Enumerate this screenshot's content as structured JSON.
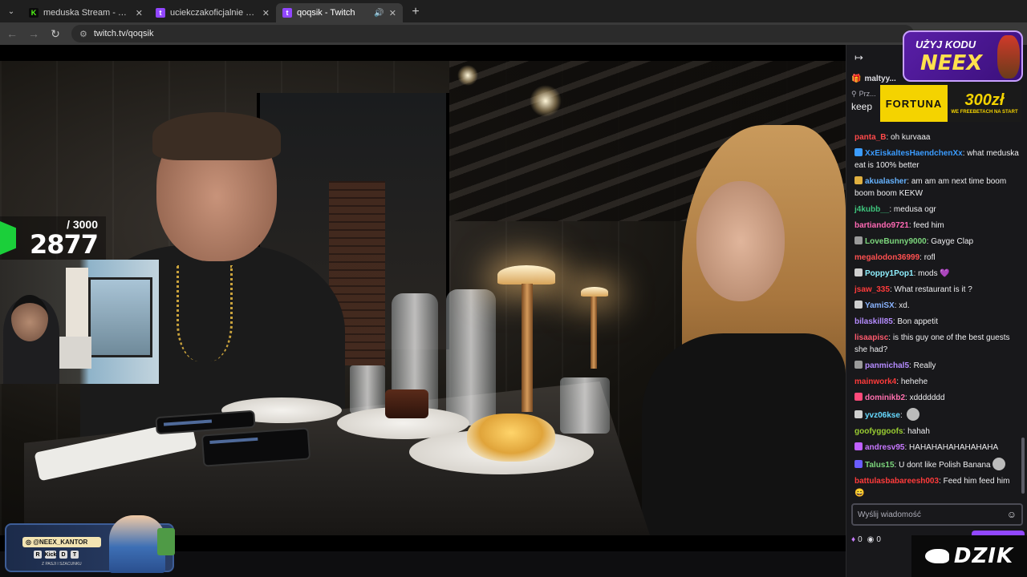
{
  "browser": {
    "tabs": [
      {
        "title": "meduska Stream - Watch Live o",
        "favicon": "kick-k-icon",
        "favicon_color": "#53fc18",
        "active": false
      },
      {
        "title": "uciekczakoficjalnie XD - Twitch",
        "favicon": "twitch-icon",
        "favicon_color": "#9146ff",
        "active": false
      },
      {
        "title": "qoqsik - Twitch",
        "favicon": "twitch-icon",
        "favicon_color": "#9146ff",
        "active": true
      }
    ],
    "url": "twitch.tv/qoqsik"
  },
  "stream": {
    "counter_goal": "/ 3000",
    "counter_value": "2877",
    "counter_color": "#1bcf3a",
    "promo_handle": "@NEEX_KANTOR",
    "promo_icons": [
      "R",
      "Kick",
      "D",
      "T"
    ],
    "promo_sub": "Z PASJI I SZACUNKU"
  },
  "chat": {
    "pinned_user": "maltyy...",
    "pinned_label": "Prz...",
    "pinned_text": "keep",
    "ad_neex": {
      "line1": "UŻYJ KODU",
      "line2": "NEEX"
    },
    "ad_fortuna": {
      "brand": "FORTUNA",
      "amount": "300zł",
      "tag": "WE FREEBETACH NA START"
    },
    "messages": [
      {
        "user": "panta_B",
        "color": "#ff4a4a",
        "text": "oh kurvaaa",
        "badge": ""
      },
      {
        "user": "XxEiskaltesHaendchenXx",
        "color": "#3b9cff",
        "text": "what meduska eat is 100% better",
        "badge": "#3b9cff"
      },
      {
        "user": "akualasher",
        "color": "#66b3ff",
        "text": "am am am next time boom boom boom KEKW",
        "badge": "#e0b040"
      },
      {
        "user": "j4kubb__",
        "color": "#3ec47c",
        "text": "medusa ogr",
        "badge": ""
      },
      {
        "user": "bartiando9721",
        "color": "#ff69b4",
        "text": "feed him",
        "badge": ""
      },
      {
        "user": "LoveBunny9000",
        "color": "#7cd67c",
        "text": "Gayge Clap",
        "badge": "#9a9a9a"
      },
      {
        "user": "megalodon36999",
        "color": "#ff5050",
        "text": "rofl",
        "badge": ""
      },
      {
        "user": "Poppy1Pop1",
        "color": "#8ff0ff",
        "text": "mods 💜",
        "badge": "#cfcfcf"
      },
      {
        "user": "jsaw_335",
        "color": "#ff3b3b",
        "text": "What restaurant is it ?",
        "badge": ""
      },
      {
        "user": "YamiSX",
        "color": "#8ab4ff",
        "text": "xd.",
        "badge": "#cfcfcf"
      },
      {
        "user": "bilaskill85",
        "color": "#b58cff",
        "text": "Bon appetit",
        "badge": ""
      },
      {
        "user": "lisaapisc",
        "color": "#ff5a6e",
        "text": "is this guy one of the best guests she had?",
        "badge": ""
      },
      {
        "user": "panmichal5",
        "color": "#b58cff",
        "text": "Really",
        "badge": "#9a9a9a"
      },
      {
        "user": "mainwork4",
        "color": "#ff3b3b",
        "text": "hehehe",
        "badge": ""
      },
      {
        "user": "dominikb2",
        "color": "#ff6fae",
        "text": "xddddddd",
        "badge": "#ff4a7a"
      },
      {
        "user": "yvz06kse",
        "color": "#66d9ff",
        "text": "",
        "badge": "#cfcfcf",
        "emote": true
      },
      {
        "user": "goofyggoofs",
        "color": "#9acd32",
        "text": "hahah",
        "badge": ""
      },
      {
        "user": "andresv95",
        "color": "#c878ff",
        "text": "HAHAHAHAHAHAHAHA",
        "badge": "#c060ff"
      },
      {
        "user": "Talus15",
        "color": "#7cd67c",
        "text": "U dont like Polish Banana",
        "badge": "#6a5cff",
        "emote": true
      },
      {
        "user": "battulasbabareesh003",
        "color": "#ff3b3b",
        "text": "Feed him feed him 😄",
        "badge": ""
      }
    ],
    "input_placeholder": "Wyślij wiadomość",
    "points1": "0",
    "points2": "0"
  },
  "sponsor_corner": "DZIK"
}
